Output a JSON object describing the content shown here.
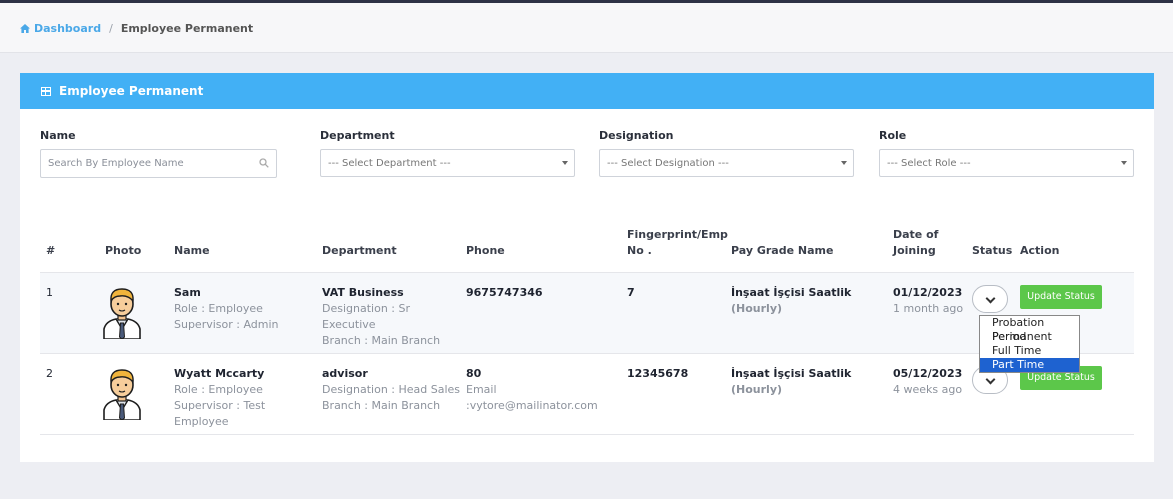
{
  "breadcrumb": {
    "home_label": "Dashboard",
    "separator": "/",
    "current": "Employee Permanent"
  },
  "card": {
    "title": "Employee Permanent"
  },
  "filters": {
    "name": {
      "label": "Name",
      "placeholder": "Search By Employee Name"
    },
    "department": {
      "label": "Department",
      "selected": "--- Select Department ---"
    },
    "designation": {
      "label": "Designation",
      "selected": "--- Select Designation ---"
    },
    "role": {
      "label": "Role",
      "selected": "--- Select Role ---"
    }
  },
  "table": {
    "headers": {
      "num": "#",
      "photo": "Photo",
      "name": "Name",
      "department": "Department",
      "phone": "Phone",
      "fingerprint_1": "Fingerprint/Emp",
      "fingerprint_2": "No .",
      "pay_grade": "Pay Grade Name",
      "doj_1": "Date of",
      "doj_2": "Joining",
      "status": "Status",
      "action": "Action"
    },
    "rows": [
      {
        "num": "1",
        "name": "Sam",
        "role": "Role : Employee",
        "supervisor": "Supervisor : Admin",
        "department": "VAT Business",
        "designation": "Designation : Sr Executive",
        "branch": "Branch : Main Branch",
        "phone": "9675747346",
        "email": "",
        "fingerprint": "7",
        "pay_grade": "İnşaat İşçisi Saatlik",
        "pay_type": "(Hourly)",
        "doj": "01/12/2023",
        "doj_ago": "1 month ago",
        "action": "Update Status"
      },
      {
        "num": "2",
        "name": "Wyatt Mccarty",
        "role": "Role : Employee",
        "supervisor": "Supervisor : Test Employee",
        "department": "advisor",
        "designation": "Designation : Head Sales",
        "branch": "Branch : Main Branch",
        "phone": "80",
        "email": "Email :vytore@mailinator.com",
        "fingerprint": "12345678",
        "pay_grade": "İnşaat İşçisi Saatlik",
        "pay_type": "(Hourly)",
        "doj": "05/12/2023",
        "doj_ago": "4 weeks ago",
        "action": "Update Status"
      }
    ]
  },
  "status_dropdown": {
    "options": [
      "Probation Period",
      "Permanent",
      "Full Time",
      "Part Time"
    ],
    "highlighted": "Part Time"
  },
  "colors": {
    "header_bar": "#42b0f5",
    "update_button": "#5cc74a",
    "link": "#4aa8e8",
    "dropdown_highlight": "#1e62d0"
  },
  "icons": {
    "home": "home-icon",
    "card": "grid-icon",
    "search": "search-icon",
    "chevron": "chevron-down-icon"
  }
}
